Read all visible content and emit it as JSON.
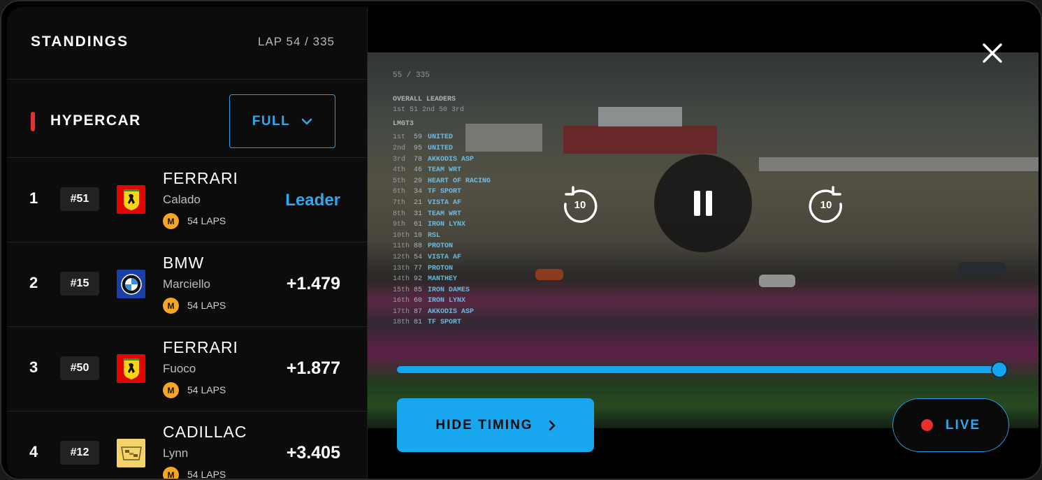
{
  "standings": {
    "title": "STANDINGS",
    "lap": "LAP 54 / 335",
    "class_name": "HYPERCAR",
    "filter_label": "FULL",
    "rows": [
      {
        "pos": "1",
        "num": "#51",
        "team": "FERRARI",
        "driver": "Calado",
        "tyre": "M",
        "laps": "54 LAPS",
        "gap": "Leader",
        "logo": "ferrari-logo"
      },
      {
        "pos": "2",
        "num": "#15",
        "team": "BMW",
        "driver": "Marciello",
        "tyre": "M",
        "laps": "54 LAPS",
        "gap": "+1.479",
        "logo": "bmw-logo"
      },
      {
        "pos": "3",
        "num": "#50",
        "team": "FERRARI",
        "driver": "Fuoco",
        "tyre": "M",
        "laps": "54 LAPS",
        "gap": "+1.877",
        "logo": "ferrari-logo"
      },
      {
        "pos": "4",
        "num": "#12",
        "team": "CADILLAC",
        "driver": "Lynn",
        "tyre": "M",
        "laps": "54 LAPS",
        "gap": "+3.405",
        "logo": "cadillac-logo"
      }
    ]
  },
  "video_overlay": {
    "lap": "55 / 335",
    "overall_title": "OVERALL LEADERS",
    "overall_line": "1st  51  2nd  50  3rd",
    "class_title": "LMGT3",
    "entries": [
      {
        "p": "1st",
        "no": "59",
        "team": "UNITED"
      },
      {
        "p": "2nd",
        "no": "95",
        "team": "UNITED"
      },
      {
        "p": "3rd",
        "no": "78",
        "team": "AKKODIS ASP"
      },
      {
        "p": "4th",
        "no": "46",
        "team": "TEAM WRT"
      },
      {
        "p": "5th",
        "no": "29",
        "team": "HEART OF RACING"
      },
      {
        "p": "6th",
        "no": "34",
        "team": "TF SPORT"
      },
      {
        "p": "7th",
        "no": "21",
        "team": "VISTA AF"
      },
      {
        "p": "8th",
        "no": "31",
        "team": "TEAM WRT"
      },
      {
        "p": "9th",
        "no": "61",
        "team": "IRON LYNX"
      },
      {
        "p": "10th",
        "no": "10",
        "team": "RSL"
      },
      {
        "p": "11th",
        "no": "88",
        "team": "PROTON"
      },
      {
        "p": "12th",
        "no": "54",
        "team": "VISTA AF"
      },
      {
        "p": "13th",
        "no": "77",
        "team": "PROTON"
      },
      {
        "p": "14th",
        "no": "92",
        "team": "MANTHEY"
      },
      {
        "p": "15th",
        "no": "85",
        "team": "IRON DAMES"
      },
      {
        "p": "16th",
        "no": "60",
        "team": "IRON LYNX"
      },
      {
        "p": "17th",
        "no": "87",
        "team": "AKKODIS ASP"
      },
      {
        "p": "18th",
        "no": "81",
        "team": "TF SPORT"
      }
    ]
  },
  "player": {
    "rewind_seconds": "10",
    "forward_seconds": "10",
    "progress": 1.0,
    "hide_timing_label": "HIDE TIMING",
    "live_label": "LIVE"
  },
  "colors": {
    "accent": "#16a6ee",
    "live": "#e4312b",
    "tyre_medium": "#f5a623"
  },
  "icons": [
    "chevron-down-icon",
    "play-pause-icon",
    "rewind-10-icon",
    "forward-10-icon",
    "chevron-right-icon",
    "close-icon"
  ]
}
